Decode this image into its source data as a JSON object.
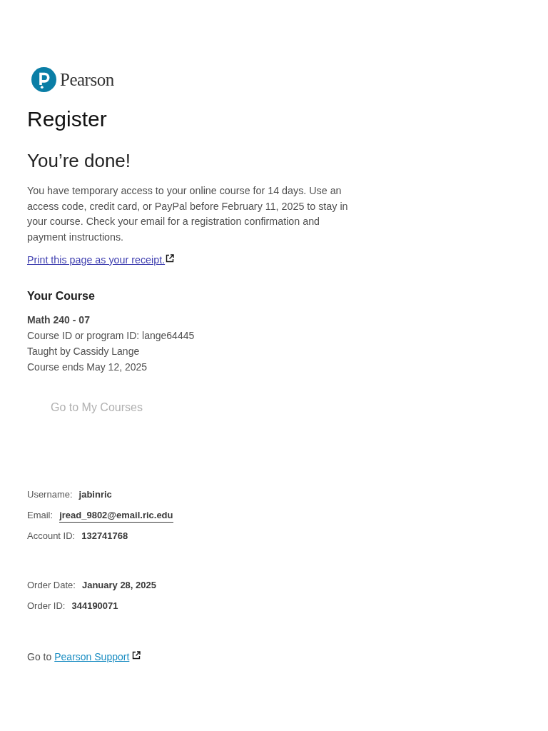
{
  "logo": {
    "wordmark": "Pearson"
  },
  "page_title": "Register",
  "heading": "You’re done!",
  "message": "You have temporary access to your online course for 14 days. Use an access code, credit card, or PayPal before February 11, 2025 to stay in your course. Check your email for a registration confirmation and payment instructions.",
  "receipt_link": {
    "label": "Print this page as your receipt."
  },
  "course": {
    "heading": "Your Course",
    "name": "Math 240 - 07",
    "details": [
      "Course ID or program ID: lange64445",
      "Taught by Cassidy Lange",
      "Course ends May 12, 2025"
    ]
  },
  "my_courses_button": {
    "label": "Go to My Courses",
    "disabled": true
  },
  "account": [
    {
      "label": "Username:",
      "value": "jabinric",
      "kind": "text"
    },
    {
      "label": "Email:",
      "value": "jread_9802@email.ric.edu",
      "kind": "link"
    },
    {
      "label": "Account ID:",
      "value": "132741768",
      "kind": "text"
    }
  ],
  "order": [
    {
      "label": "Order Date:",
      "value": "January 28, 2025",
      "kind": "text"
    },
    {
      "label": "Order ID:",
      "value": "344190071",
      "kind": "text"
    }
  ],
  "support": {
    "prefix": "Go to",
    "link": "Pearson Support"
  }
}
